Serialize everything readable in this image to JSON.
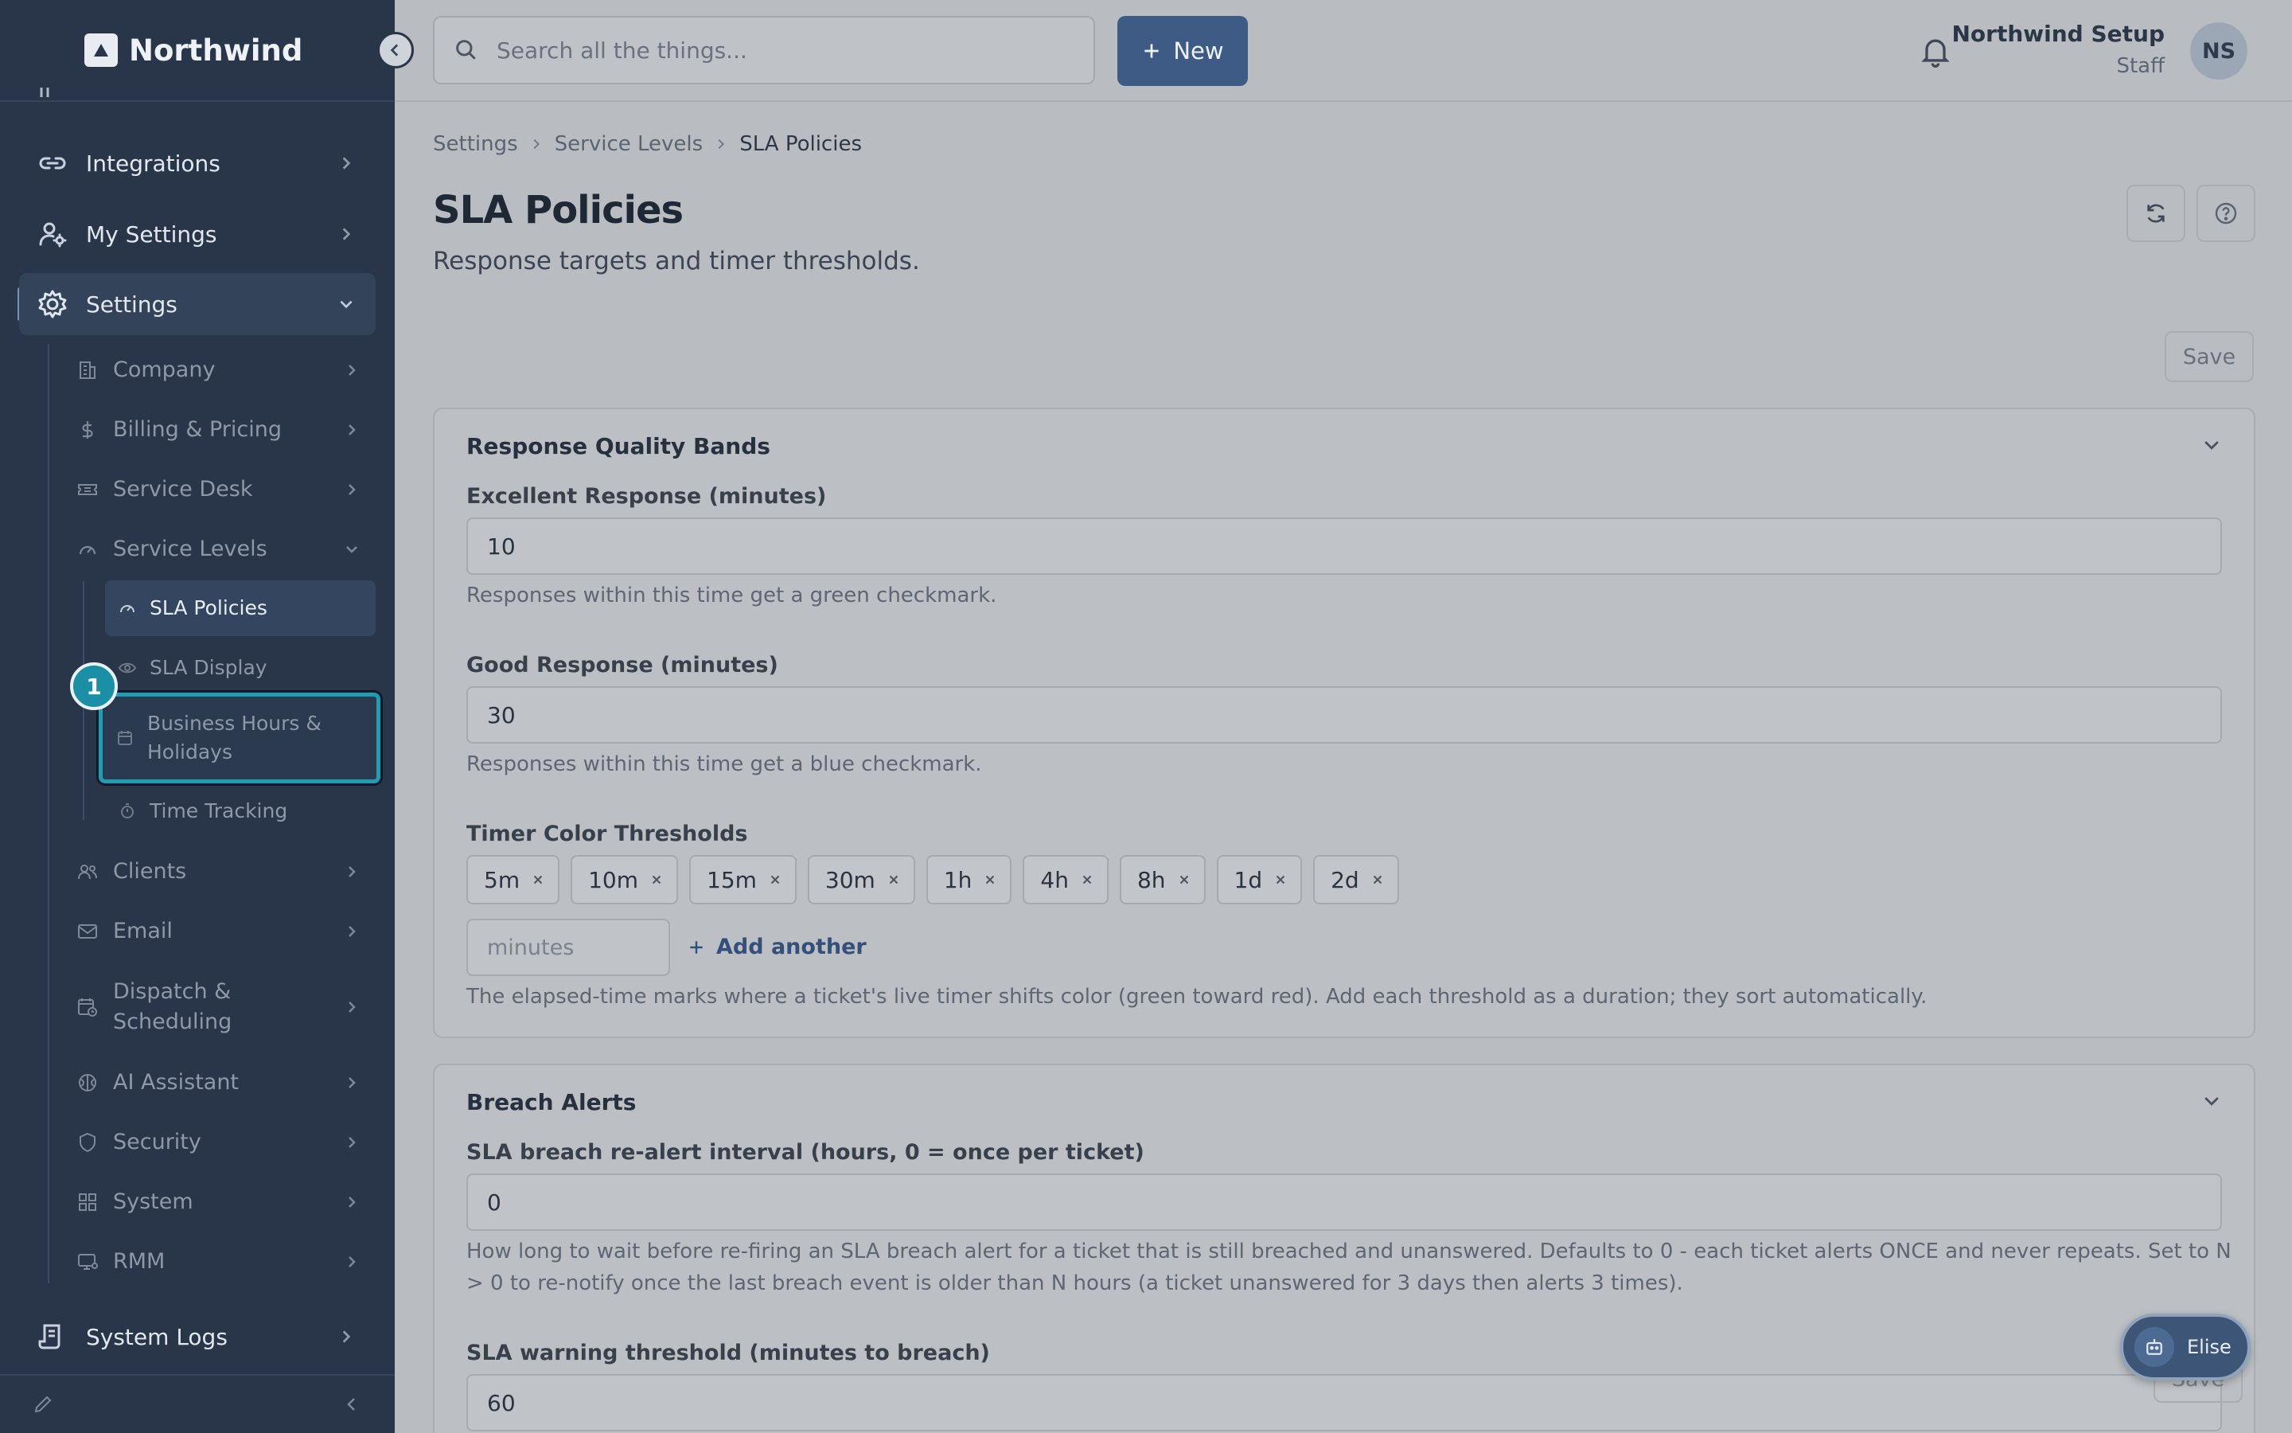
{
  "brand": {
    "name": "Northwind"
  },
  "sidebar": {
    "top_items": [
      {
        "label": "Integrations",
        "icon": "link-icon"
      },
      {
        "label": "My Settings",
        "icon": "user-gear-icon"
      },
      {
        "label": "Settings",
        "icon": "gear-icon",
        "expanded": true
      }
    ],
    "settings_items": [
      {
        "label": "Company",
        "icon": "building-icon"
      },
      {
        "label": "Billing & Pricing",
        "icon": "dollar-icon"
      },
      {
        "label": "Service Desk",
        "icon": "ticket-icon"
      },
      {
        "label": "Service Levels",
        "icon": "gauge-icon",
        "expanded": true
      },
      {
        "label": "Clients",
        "icon": "users-icon"
      },
      {
        "label": "Email",
        "icon": "mail-icon"
      },
      {
        "label": "Dispatch & Scheduling",
        "icon": "calendar-clock-icon"
      },
      {
        "label": "AI Assistant",
        "icon": "brain-icon"
      },
      {
        "label": "Security",
        "icon": "shield-icon"
      },
      {
        "label": "System",
        "icon": "grid-icon"
      },
      {
        "label": "RMM",
        "icon": "monitor-icon"
      }
    ],
    "service_level_items": [
      {
        "label": "SLA Policies",
        "icon": "gauge-icon",
        "current": true
      },
      {
        "label": "SLA Display",
        "icon": "eye-icon"
      },
      {
        "label": "Business Hours & Holidays",
        "icon": "calendar-icon",
        "highlighted": true
      },
      {
        "label": "Time Tracking",
        "icon": "stopwatch-icon"
      }
    ],
    "bottom_item": {
      "label": "System Logs",
      "icon": "logs-icon"
    },
    "step_badge": "1"
  },
  "topbar": {
    "search_placeholder": "Search all the things...",
    "new_label": "New",
    "user_name": "Northwind Setup",
    "user_role": "Staff",
    "avatar_initials": "NS"
  },
  "breadcrumb": [
    "Settings",
    "Service Levels",
    "SLA Policies"
  ],
  "page": {
    "title": "SLA Policies",
    "subtitle": "Response targets and timer thresholds.",
    "save_label": "Save"
  },
  "quality_bands": {
    "title": "Response Quality Bands",
    "excellent_label": "Excellent Response (minutes)",
    "excellent_value": "10",
    "excellent_help": "Responses within this time get a green checkmark.",
    "good_label": "Good Response (minutes)",
    "good_value": "30",
    "good_help": "Responses within this time get a blue checkmark.",
    "thresholds_label": "Timer Color Thresholds",
    "thresholds": [
      "5m",
      "10m",
      "15m",
      "30m",
      "1h",
      "4h",
      "8h",
      "1d",
      "2d"
    ],
    "minutes_placeholder": "minutes",
    "add_another": "Add another",
    "thresholds_help": "The elapsed-time marks where a ticket's live timer shifts color (green toward red). Add each threshold as a duration; they sort automatically."
  },
  "breach_alerts": {
    "title": "Breach Alerts",
    "realert_label": "SLA breach re-alert interval (hours, 0 = once per ticket)",
    "realert_value": "0",
    "realert_help": "How long to wait before re-firing an SLA breach alert for a ticket that is still breached and unanswered. Defaults to 0 - each ticket alerts ONCE and never repeats. Set to N > 0 to re-notify once the last breach event is older than N hours (a ticket unanswered for 3 days then alerts 3 times).",
    "warning_label": "SLA warning threshold (minutes to breach)",
    "warning_value": "60"
  },
  "assistant": {
    "label": "Elise"
  }
}
